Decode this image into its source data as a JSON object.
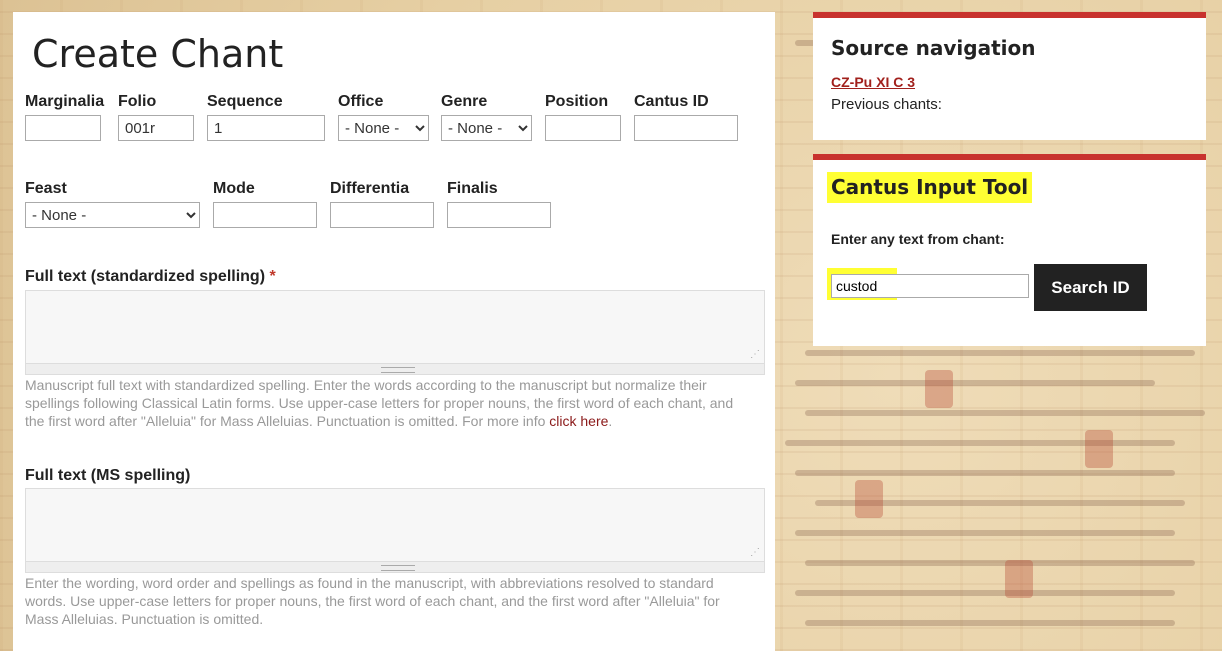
{
  "page": {
    "title": "Create Chant"
  },
  "form": {
    "marginalia": {
      "label": "Marginalia",
      "value": ""
    },
    "folio": {
      "label": "Folio",
      "value": "001r"
    },
    "sequence": {
      "label": "Sequence",
      "value": "1"
    },
    "office": {
      "label": "Office",
      "selected": "- None -"
    },
    "genre": {
      "label": "Genre",
      "selected": "- None -"
    },
    "position": {
      "label": "Position",
      "value": ""
    },
    "cantus_id": {
      "label": "Cantus ID",
      "value": ""
    },
    "feast": {
      "label": "Feast",
      "selected": "- None -"
    },
    "mode": {
      "label": "Mode",
      "value": ""
    },
    "differentia": {
      "label": "Differentia",
      "value": ""
    },
    "finalis": {
      "label": "Finalis",
      "value": ""
    },
    "full_text_std": {
      "label": "Full text (standardized spelling)",
      "required_mark": "*",
      "help": "Manuscript full text with standardized spelling. Enter the words according to the manuscript but normalize their spellings following Classical Latin forms. Use upper-case letters for proper nouns, the first word of each chant, and the first word after \"Alleluia\" for Mass Alleluias. Punctuation is omitted. For more info ",
      "help_link": "click here",
      "help_end": "."
    },
    "full_text_ms": {
      "label": "Full text (MS spelling)",
      "help": "Enter the wording, word order and spellings as found in the manuscript, with abbreviations resolved to standard words. Use upper-case letters for proper nouns, the first word of each chant, and the first word after \"Alleluia\" for Mass Alleluias. Punctuation is omitted."
    }
  },
  "source_nav": {
    "title": "Source navigation",
    "source": "CZ-Pu XI C 3",
    "previous_label": "Previous chants:"
  },
  "cantus_tool": {
    "title": "Cantus Input Tool",
    "prompt": "Enter any text from chant:",
    "input_value": "custod",
    "button_label": "Search ID"
  },
  "colors": {
    "accent": "#c8322e",
    "link": "#a1201c",
    "highlight": "#ffff33",
    "button_bg": "#222222"
  }
}
